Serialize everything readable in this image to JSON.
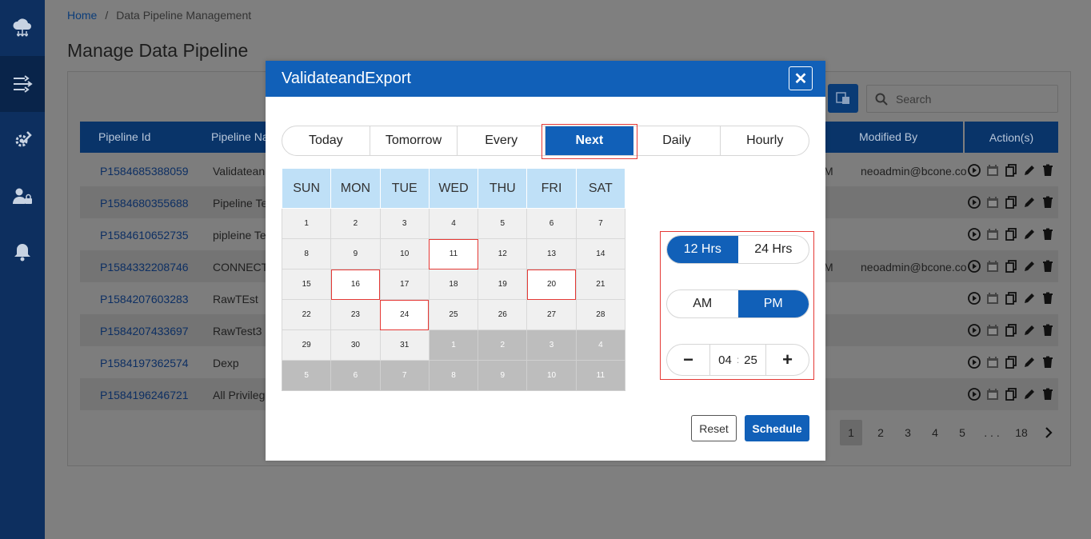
{
  "breadcrumb": {
    "home": "Home",
    "separator": "/",
    "current": "Data Pipeline Management"
  },
  "page": {
    "title": "Manage Data Pipeline"
  },
  "search": {
    "placeholder": "Search"
  },
  "table": {
    "headers": [
      "Pipeline Id",
      "Pipeline Na",
      "Modified By",
      "Action(s)"
    ],
    "rows": [
      {
        "id": "P1584685388059",
        "name": "Validatean",
        "m": "M",
        "modified_by": "neoadmin@bcone.co"
      },
      {
        "id": "P1584680355688",
        "name": "Pipeline Te",
        "m": "",
        "modified_by": ""
      },
      {
        "id": "P1584610652735",
        "name": "pipleine Te",
        "m": "",
        "modified_by": ""
      },
      {
        "id": "P1584332208746",
        "name": "CONNECTI",
        "m": "M",
        "modified_by": "neoadmin@bcone.co"
      },
      {
        "id": "P1584207603283",
        "name": "RawTEst",
        "m": "",
        "modified_by": ""
      },
      {
        "id": "P1584207433697",
        "name": "RawTest3",
        "m": "",
        "modified_by": ""
      },
      {
        "id": "P1584197362574",
        "name": "Dexp",
        "m": "",
        "modified_by": ""
      },
      {
        "id": "P1584196246721",
        "name": "All Privilege",
        "m": "",
        "modified_by": ""
      }
    ]
  },
  "pagination": {
    "pages": [
      "1",
      "2",
      "3",
      "4",
      "5"
    ],
    "ellipsis": ". . .",
    "last": "18",
    "current": "1"
  },
  "modal": {
    "title": "ValidateandExport",
    "close": "✕",
    "tabs": [
      "Today",
      "Tomorrow",
      "Every",
      "Next",
      "Daily",
      "Hourly"
    ],
    "active_tab": "Next",
    "weekdays": [
      "SUN",
      "MON",
      "TUE",
      "WED",
      "THU",
      "FRI",
      "SAT"
    ],
    "weeks": [
      [
        "1",
        "2",
        "3",
        "4",
        "5",
        "6",
        "7"
      ],
      [
        "8",
        "9",
        "10",
        "11",
        "12",
        "13",
        "14"
      ],
      [
        "15",
        "16",
        "17",
        "18",
        "19",
        "20",
        "21"
      ],
      [
        "22",
        "23",
        "24",
        "25",
        "26",
        "27",
        "28"
      ],
      [
        "29",
        "30",
        "31",
        "1",
        "2",
        "3",
        "4"
      ],
      [
        "5",
        "6",
        "7",
        "8",
        "9",
        "10",
        "11"
      ]
    ],
    "marked_days": [
      "11",
      "16",
      "20",
      "24"
    ],
    "hour_format": {
      "options": [
        "12 Hrs",
        "24 Hrs"
      ],
      "selected": "12 Hrs"
    },
    "meridiem": {
      "options": [
        "AM",
        "PM"
      ],
      "selected": "PM"
    },
    "time": {
      "hour": "04",
      "minute": "25",
      "separator": ":",
      "minus": "−",
      "plus": "+"
    },
    "reset_label": "Reset",
    "schedule_label": "Schedule"
  },
  "colors": {
    "primary": "#1160b8",
    "sidebar": "#0d2f5f",
    "header_bg": "#093469",
    "highlight_border": "#e53935",
    "weekday_bg": "#bfe0f7"
  },
  "icons": {
    "sidebar": [
      "cloud-network-icon",
      "pipeline-icon",
      "settings-tools-icon",
      "user-lock-icon",
      "bell-icon"
    ],
    "row_actions": [
      "play-icon",
      "calendar-icon",
      "copy-icon",
      "edit-icon",
      "delete-icon"
    ]
  }
}
